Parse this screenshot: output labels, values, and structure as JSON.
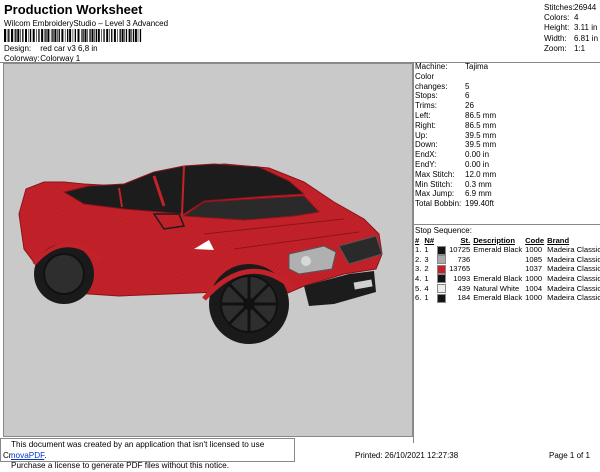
{
  "header": {
    "title": "Production Worksheet",
    "subtitle": "Wilcom EmbroideryStudio – Level 3 Advanced",
    "design_label": "Design:",
    "design_value": "red car v3 6,8 in",
    "colorway_label": "Colorway:",
    "colorway_value": "Colorway 1"
  },
  "stats": [
    {
      "label": "Stitches:",
      "value": "26944"
    },
    {
      "label": "Colors:",
      "value": "4"
    },
    {
      "label": "Height:",
      "value": "3.11 in"
    },
    {
      "label": "Width:",
      "value": "6.81 in"
    },
    {
      "label": "Zoom:",
      "value": "1:1"
    }
  ],
  "machine_info": [
    {
      "label": "Machine:",
      "value": "Tajima"
    },
    {
      "label": "Color changes:",
      "value": "5"
    },
    {
      "label": "Stops:",
      "value": "6"
    },
    {
      "label": "Trims:",
      "value": "26"
    },
    {
      "label": "Left:",
      "value": "86.5 mm"
    },
    {
      "label": "Right:",
      "value": "86.5 mm"
    },
    {
      "label": "Up:",
      "value": "39.5 mm"
    },
    {
      "label": "Down:",
      "value": "39.5 mm"
    },
    {
      "label": "EndX:",
      "value": "0.00 in"
    },
    {
      "label": "EndY:",
      "value": "0.00 in"
    },
    {
      "label": "Max Stitch:",
      "value": "12.0 mm"
    },
    {
      "label": "Min Stitch:",
      "value": "0.3 mm"
    },
    {
      "label": "Max Jump:",
      "value": "6.9 mm"
    },
    {
      "label": "Total Bobbin:",
      "value": "199.40ft"
    }
  ],
  "stop_sequence": {
    "title": "Stop Sequence:",
    "headers": [
      "#",
      "N#",
      "",
      "St.",
      "Description",
      "Code",
      "Brand"
    ],
    "rows": [
      {
        "num": "1.",
        "n": "1",
        "color": "#141414",
        "st": "10725",
        "desc": "Emerald Black",
        "code": "1000",
        "brand": "Madeira Classic 40"
      },
      {
        "num": "2.",
        "n": "3",
        "color": "#a9a9a9",
        "st": "736",
        "desc": "",
        "code": "1085",
        "brand": "Madeira Classic 40"
      },
      {
        "num": "3.",
        "n": "2",
        "color": "#c4222a",
        "st": "13765",
        "desc": "",
        "code": "1037",
        "brand": "Madeira Classic 40"
      },
      {
        "num": "4.",
        "n": "1",
        "color": "#141414",
        "st": "1093",
        "desc": "Emerald Black",
        "code": "1000",
        "brand": "Madeira Classic 40"
      },
      {
        "num": "5.",
        "n": "4",
        "color": "#eeeeee",
        "st": "439",
        "desc": "Natural White",
        "code": "1004",
        "brand": "Madeira Classic 40"
      },
      {
        "num": "6.",
        "n": "1",
        "color": "#141414",
        "st": "184",
        "desc": "Emerald Black",
        "code": "1000",
        "brand": "Madeira Classic 40"
      }
    ]
  },
  "notice": {
    "line1_prefix": "This document was created by an application that isn't licensed to use ",
    "link": "novaPDF",
    "line1_suffix": ".",
    "line2": "Purchase a license to generate PDF files without this notice."
  },
  "footer": {
    "left_fragment": "Cr",
    "printed": "Printed: 26/10/2021 12:27:38",
    "page": "Page 1 of 1"
  },
  "colors": {
    "canvas": "#c9c9c9",
    "car_body": "#c4222a",
    "tire": "#141414"
  }
}
